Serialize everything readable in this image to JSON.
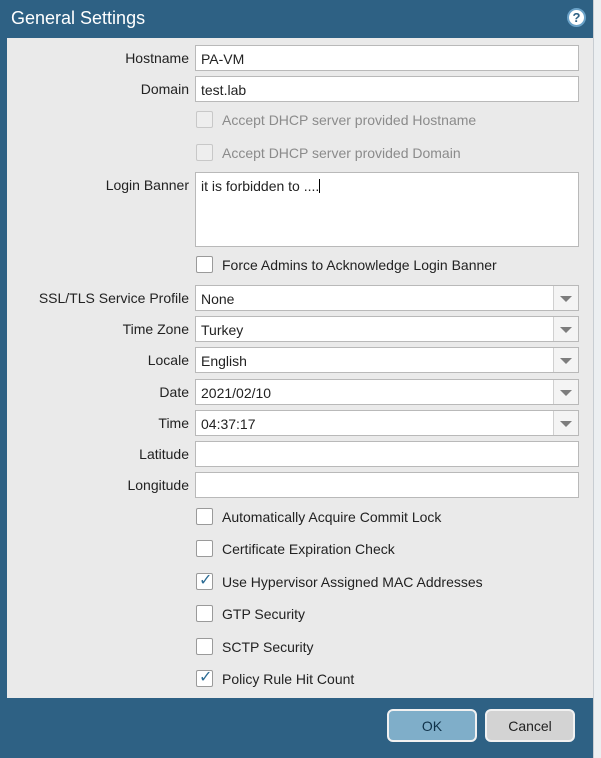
{
  "dialog": {
    "title": "General Settings",
    "help_icon": "question-circle-icon"
  },
  "form": {
    "hostname": {
      "label": "Hostname",
      "value": "PA-VM"
    },
    "domain": {
      "label": "Domain",
      "value": "test.lab"
    },
    "dhcp_hostname": {
      "label": "Accept DHCP server provided Hostname",
      "checked": false,
      "disabled": true
    },
    "dhcp_domain": {
      "label": "Accept DHCP server provided Domain",
      "checked": false,
      "disabled": true
    },
    "login_banner": {
      "label": "Login Banner",
      "value": "it is forbidden to ...."
    },
    "force_ack": {
      "label": "Force Admins to Acknowledge Login Banner",
      "checked": false
    },
    "ssl_tls": {
      "label": "SSL/TLS Service Profile",
      "value": "None"
    },
    "time_zone": {
      "label": "Time Zone",
      "value": "Turkey"
    },
    "locale": {
      "label": "Locale",
      "value": "English"
    },
    "date": {
      "label": "Date",
      "value": "2021/02/10"
    },
    "time": {
      "label": "Time",
      "value": "04:37:17"
    },
    "latitude": {
      "label": "Latitude",
      "value": ""
    },
    "longitude": {
      "label": "Longitude",
      "value": ""
    },
    "commit_lock": {
      "label": "Automatically Acquire Commit Lock",
      "checked": false
    },
    "cert_exp": {
      "label": "Certificate Expiration Check",
      "checked": false
    },
    "hypervisor_mac": {
      "label": "Use Hypervisor Assigned MAC Addresses",
      "checked": true
    },
    "gtp": {
      "label": "GTP Security",
      "checked": false
    },
    "sctp": {
      "label": "SCTP Security",
      "checked": false
    },
    "hit_count": {
      "label": "Policy Rule Hit Count",
      "checked": true
    }
  },
  "buttons": {
    "ok": "OK",
    "cancel": "Cancel"
  },
  "colors": {
    "header": "#2e6184",
    "body": "#eaeaea",
    "ok_button": "#7faec9",
    "check": "#2d6c94"
  }
}
